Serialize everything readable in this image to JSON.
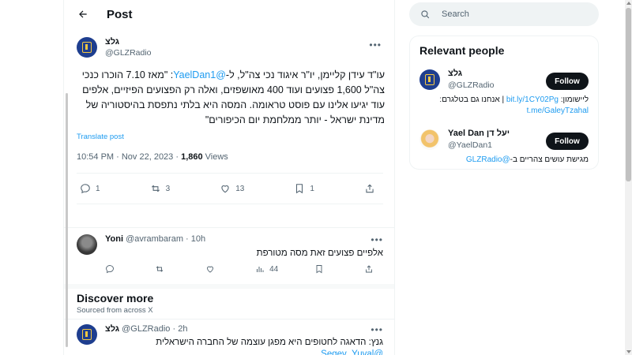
{
  "header": {
    "title": "Post"
  },
  "tweet": {
    "display_name": "גלצ",
    "handle": "@GLZRadio",
    "body_before": "עו\"ד עידן קליימן, יו\"ר איגוד נכי צה\"ל, ל-",
    "mention": "@YaelDan1",
    "body_after": ": \"מאז 7.10 הוכרו כנכי צה\"ל 1,600 פצועים ועוד 400 מאושפזים, ואלה רק הפצועים הפיזיים, אלפים עוד יגיעו אלינו עם פוסט טראומה. המסה היא בלתי נתפסת בהיסטוריה של מדינת ישראל - יותר ממלחמת יום הכיפורים\"",
    "translate": "Translate post",
    "time": "10:54 PM · Nov 22, 2023 · ",
    "views_count": "1,860",
    "views_label": " Views",
    "actions": {
      "replies": "1",
      "retweets": "3",
      "likes": "13",
      "bookmarks": "1"
    }
  },
  "reply": {
    "name": "Yoni",
    "handle": "@avrambaram",
    "time": " · 10h",
    "text": "אלפיים פצועים זאת מסה מטורפת",
    "views": "44"
  },
  "discover": {
    "title": "Discover more",
    "subtitle": "Sourced from across X"
  },
  "tweet3": {
    "name": "גלצ",
    "handle": "@GLZRadio",
    "time": " · 2h",
    "text": "גנץ: הדאגה לחטופים היא מפגן עוצמה של החברה הישראלית",
    "mention": "@Segev_Yuval"
  },
  "search": {
    "placeholder": "Search"
  },
  "relevant": {
    "title": "Relevant people",
    "follow_label": "Follow",
    "people": [
      {
        "name": "גלצ",
        "handle": "@GLZRadio",
        "bio_prefix": "ליישומון: ",
        "bio_link1": "bit.ly/1CY02Pg",
        "bio_mid": " | אנחנו גם בטלגרם: ",
        "bio_link2": "t.me/GaleyTzahal"
      },
      {
        "name": "Yael Dan יעל דן",
        "handle": "@YaelDan1",
        "bio_prefix": "מגישת עושים צהריים ב-",
        "bio_link1": "@GLZRadio"
      }
    ]
  },
  "colors": {
    "link": "#1d9bf0",
    "follow_bg": "#0f1419",
    "glz_blue": "#1e3e8f"
  }
}
